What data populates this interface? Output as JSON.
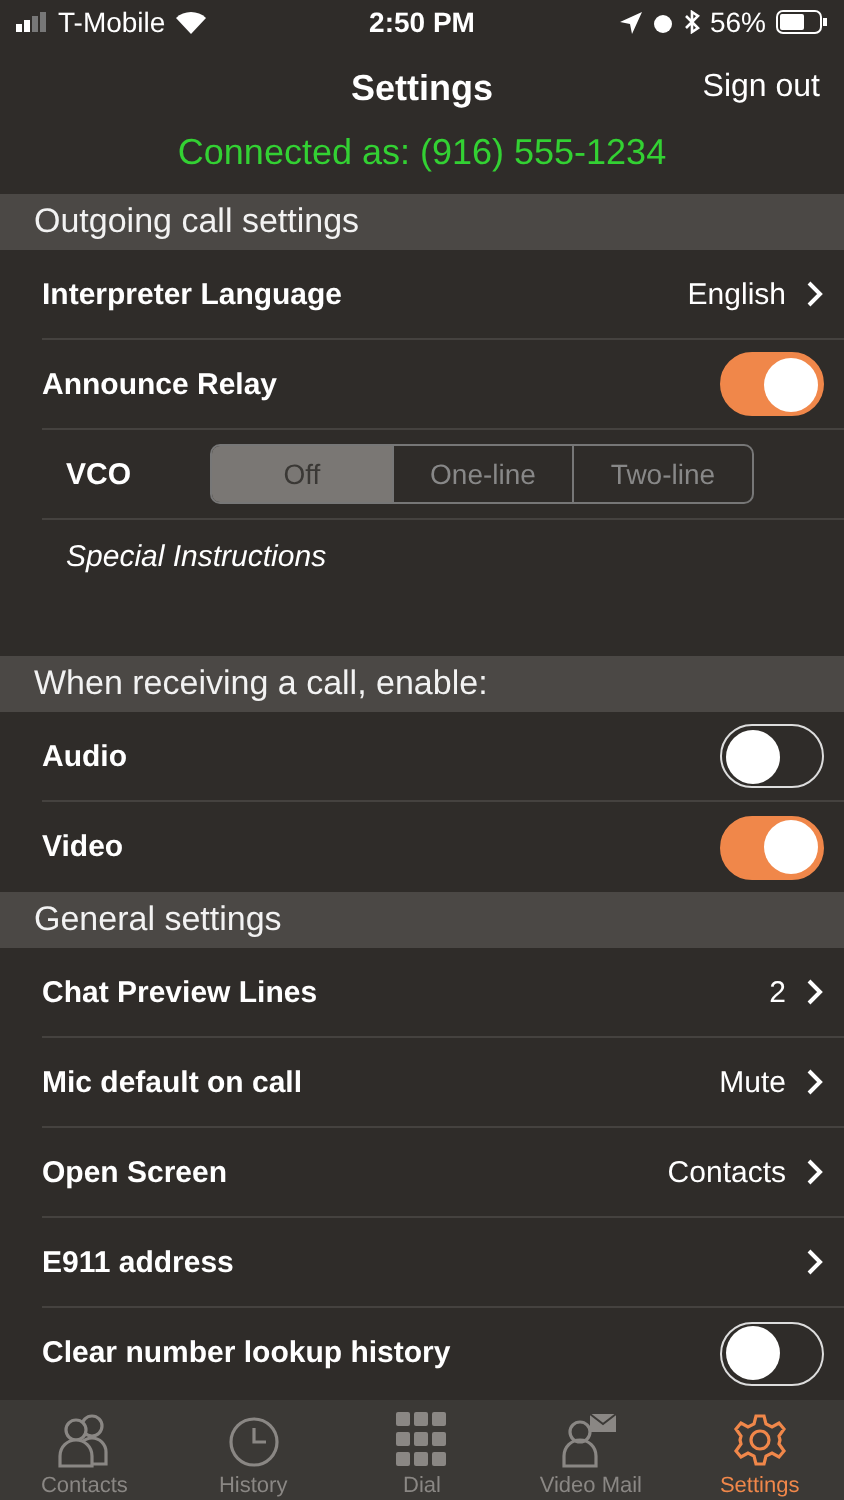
{
  "status_bar": {
    "carrier": "T-Mobile",
    "time": "2:50 PM",
    "battery": "56%"
  },
  "nav": {
    "title": "Settings",
    "action": "Sign out",
    "connected": "Connected as: (916) 555-1234"
  },
  "sections": [
    {
      "title": "Outgoing call settings",
      "rows": [
        {
          "kind": "disclosure",
          "label": "Interpreter Language",
          "value": "English"
        },
        {
          "kind": "toggle",
          "label": "Announce Relay",
          "on": true
        },
        {
          "kind": "segmented",
          "label": "VCO",
          "options": [
            {
              "label": "Off",
              "selected": true
            },
            {
              "label": "One-line",
              "selected": false
            },
            {
              "label": "Two-line",
              "selected": false
            }
          ]
        },
        {
          "kind": "note",
          "label": "Special Instructions"
        }
      ]
    },
    {
      "title": "When receiving a call, enable:",
      "rows": [
        {
          "kind": "toggle",
          "label": "Audio",
          "on": false
        },
        {
          "kind": "toggle",
          "label": "Video",
          "on": true
        }
      ]
    },
    {
      "title": "General settings",
      "rows": [
        {
          "kind": "disclosure",
          "label": "Chat Preview Lines",
          "value": "2"
        },
        {
          "kind": "disclosure",
          "label": "Mic default on call",
          "value": "Mute"
        },
        {
          "kind": "disclosure",
          "label": "Open Screen",
          "value": "Contacts"
        },
        {
          "kind": "disclosure",
          "label": "E911 address"
        },
        {
          "kind": "toggle",
          "label": "Clear number lookup history",
          "on": false
        }
      ]
    }
  ],
  "tabs": [
    {
      "label": "Contacts",
      "selected": false
    },
    {
      "label": "History",
      "selected": false
    },
    {
      "label": "Dial",
      "selected": false
    },
    {
      "label": "Video Mail",
      "selected": false
    },
    {
      "label": "Settings",
      "selected": true
    }
  ]
}
